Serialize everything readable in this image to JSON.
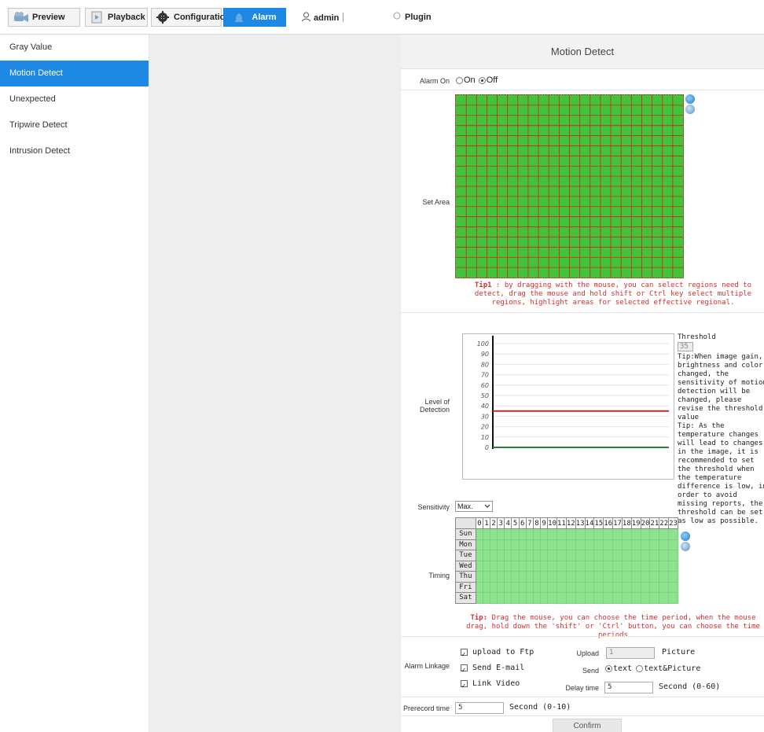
{
  "topbar": {
    "tabs": [
      {
        "label": "Preview",
        "icon": "camera-icon"
      },
      {
        "label": "Playback",
        "icon": "film-icon"
      },
      {
        "label": "Configuration",
        "icon": "gear-icon"
      },
      {
        "label": "Alarm",
        "icon": "bell-icon"
      }
    ],
    "user": "admin",
    "plugin": "Plugin"
  },
  "sidebar": {
    "items": [
      "Gray Value",
      "Motion Detect",
      "Unexpected",
      "Tripwire Detect",
      "Intrusion Detect"
    ],
    "active_index": 1
  },
  "page": {
    "title": "Motion Detect",
    "alarm_on": {
      "label": "Alarm On",
      "options": [
        "On",
        "Off"
      ],
      "selected": "Off"
    },
    "set_area": {
      "label": "Set Area",
      "tip_prefix": "Tip1",
      "tip_text": " : by dragging with the mouse, you can select regions need to detect, drag the mouse and hold shift or Ctrl key select multiple regions, highlight areas for selected effective regional."
    },
    "level": {
      "label": "Level of Detection",
      "threshold_label": "Threshold",
      "threshold_value": "35",
      "tip1": "Tip:When image gain, brightness and color changed, the sensitivity of motion detection will be changed, please revise the threshold value",
      "tip2": "Tip: As the temperature changes will lead to changes in the image, it is recommended to set the threshold when the temperature difference is low, in order to avoid missing reports, the threshold can be set as low as possible."
    },
    "sensitivity": {
      "label": "Sensitivity",
      "value": "Max."
    },
    "timing": {
      "label": "Timing",
      "days": [
        "Sun",
        "Mon",
        "Tue",
        "Wed",
        "Thu",
        "Fri",
        "Sat"
      ],
      "hours": [
        "0",
        "1",
        "2",
        "3",
        "4",
        "5",
        "6",
        "7",
        "8",
        "9",
        "10",
        "11",
        "12",
        "13",
        "14",
        "15",
        "16",
        "17",
        "18",
        "19",
        "20",
        "21",
        "22",
        "23"
      ],
      "tip_prefix": "Tip:",
      "tip_text": " Drag the mouse, you can choose the time period, when the mouse drag, hold down the 'shift' or 'Ctrl' button, you can choose the time periods"
    },
    "linkage": {
      "label": "Alarm Linkage",
      "upload_ftp": "upload to Ftp",
      "send_email": "Send E-mail",
      "link_video": "Link Video",
      "upload_label": "Upload",
      "upload_value": "1",
      "upload_unit": "Picture",
      "send_label": "Send",
      "send_options": [
        "text",
        "text&Picture"
      ],
      "delay_label": "Delay time",
      "delay_value": "5",
      "delay_unit": "Second (0-60)"
    },
    "prerecord": {
      "label": "Prerecord time",
      "value": "5",
      "unit": "Second (0-10)"
    },
    "confirm": "Confirm"
  },
  "chart_data": {
    "type": "line",
    "title": "",
    "xlabel": "",
    "ylabel": "",
    "yticks": [
      100,
      90,
      80,
      70,
      60,
      50,
      40,
      30,
      20,
      10,
      0
    ],
    "ylim": [
      0,
      100
    ],
    "series": [
      {
        "values": [
          35
        ],
        "color": "#c62828"
      },
      {
        "values": [
          0
        ],
        "color": "#2e7d32"
      }
    ]
  }
}
